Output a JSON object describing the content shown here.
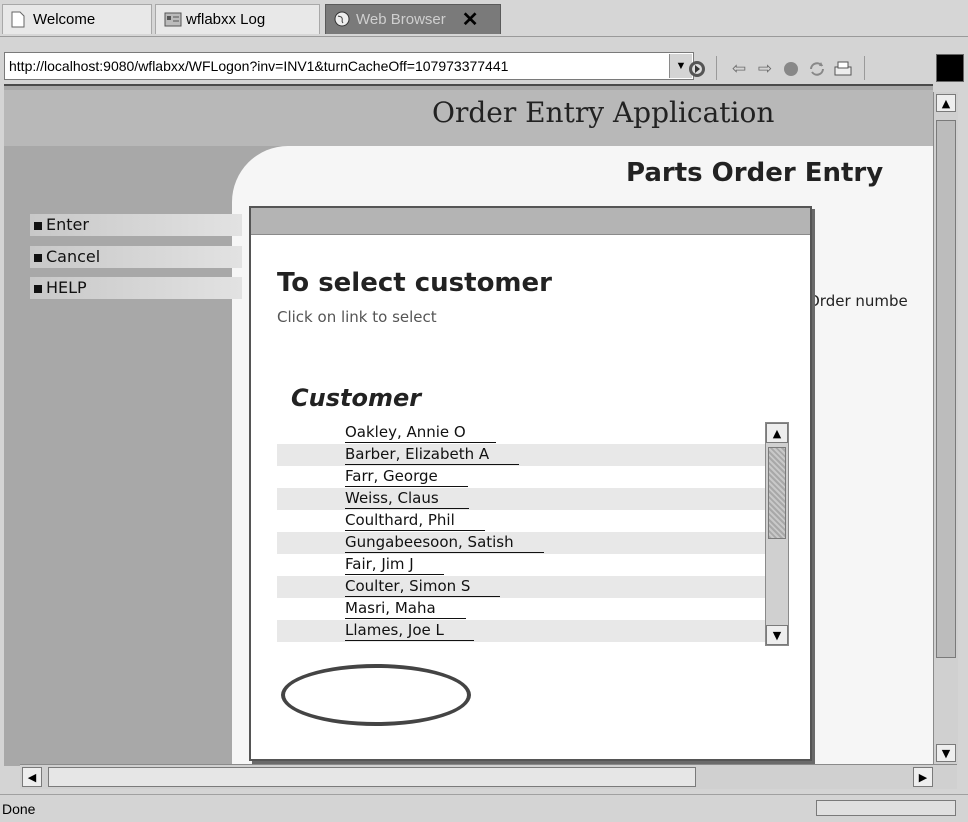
{
  "tabs": [
    {
      "label": "Welcome",
      "icon": "page-icon"
    },
    {
      "label": "wflabxx Log",
      "icon": "log-icon"
    },
    {
      "label": "Web Browser",
      "icon": "globe-icon",
      "active": true
    }
  ],
  "address_bar": {
    "url": "http://localhost:9080/wflabxx/WFLogon?inv=INV1&turnCacheOff=107973377441"
  },
  "toolbar_icons": [
    "go-icon",
    "back-icon",
    "forward-icon",
    "stop-icon",
    "refresh-icon",
    "print-icon"
  ],
  "page": {
    "app_title": "Order Entry Application",
    "subtitle": "Parts Order Entry",
    "order_number_label": "Order numbe",
    "nav": [
      "Enter",
      "Cancel",
      "HELP"
    ]
  },
  "popup": {
    "heading": "To select customer",
    "hint": "Click on link to select",
    "list_title": "Customer",
    "customers": [
      "Oakley, Annie O",
      "Barber, Elizabeth A",
      "Farr, George",
      "Weiss, Claus",
      "Coulthard, Phil",
      "Gungabeesoon, Satish",
      "Fair, Jim J",
      "Coulter, Simon S",
      "Masri, Maha",
      "Llames, Joe L"
    ]
  },
  "status": {
    "text": "Done"
  }
}
